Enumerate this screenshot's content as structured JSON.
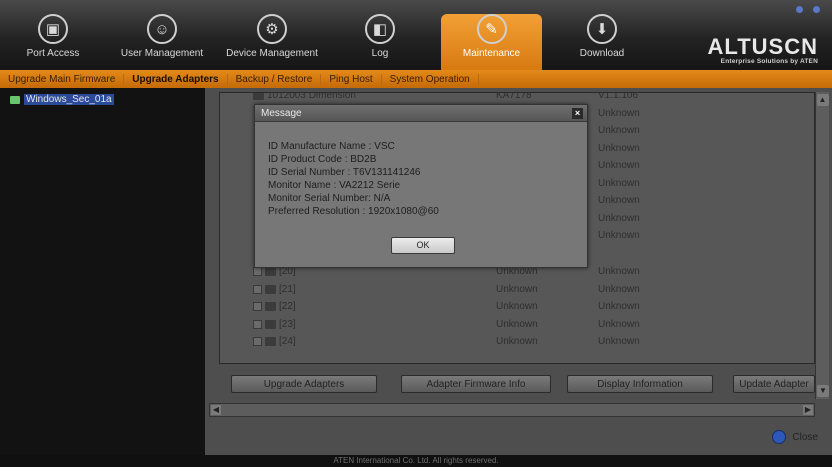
{
  "topbar": {
    "tabs": [
      {
        "label": "Port Access",
        "icon": "monitor-icon"
      },
      {
        "label": "User Management",
        "icon": "users-icon"
      },
      {
        "label": "Device Management",
        "icon": "device-icon"
      },
      {
        "label": "Log",
        "icon": "log-icon"
      },
      {
        "label": "Maintenance",
        "icon": "wrench-icon"
      },
      {
        "label": "Download",
        "icon": "download-icon"
      }
    ],
    "active_tab": "Maintenance",
    "logo": {
      "main": "ALTUSCN",
      "sub": "Enterprise Solutions by ATEN"
    }
  },
  "submenu": {
    "items": [
      "Upgrade Main Firmware",
      "Upgrade Adapters",
      "Backup / Restore",
      "Ping Host",
      "System Operation"
    ],
    "active": "Upgrade Adapters"
  },
  "tree": {
    "item": "Windows_Sec_01a"
  },
  "adapters": {
    "top_row": {
      "name": "1012003  Dimension",
      "model": "KA7178",
      "version": "V1.1.106"
    },
    "rows": [
      {
        "name": "",
        "model": "",
        "version": "Unknown"
      },
      {
        "name": "",
        "model": "",
        "version": "Unknown"
      },
      {
        "name": "",
        "model": "",
        "version": "Unknown"
      },
      {
        "name": "",
        "model": "",
        "version": "Unknown"
      },
      {
        "name": "",
        "model": "",
        "version": "Unknown"
      },
      {
        "name": "",
        "model": "",
        "version": "Unknown"
      },
      {
        "name": "",
        "model": "",
        "version": "Unknown"
      },
      {
        "name": "",
        "model": "",
        "version": "Unknown"
      },
      {
        "name": "[20]",
        "model": "Unknown",
        "version": "Unknown"
      },
      {
        "name": "[21]",
        "model": "Unknown",
        "version": "Unknown"
      },
      {
        "name": "[22]",
        "model": "Unknown",
        "version": "Unknown"
      },
      {
        "name": "[23]",
        "model": "Unknown",
        "version": "Unknown"
      },
      {
        "name": "[24]",
        "model": "Unknown",
        "version": "Unknown"
      }
    ]
  },
  "buttons": {
    "upgrade": "Upgrade Adapters",
    "firmware_info": "Adapter Firmware Info",
    "display_info": "Display Information",
    "update": "Update Adapter"
  },
  "close_label": "Close",
  "footer": "ATEN International Co. Ltd. All rights reserved.",
  "dialog": {
    "title": "Message",
    "close_glyph": "×",
    "lines": [
      "ID Manufacture Name : VSC",
      "ID Product Code : BD2B",
      "ID Serial Number : T6V131141246",
      "Monitor Name : VA2212 Serie",
      "Monitor Serial Number: N/A",
      "Preferred Resolution : 1920x1080@60"
    ],
    "ok_label": "OK"
  },
  "colors": {
    "accent": "#e48a1a",
    "pane": "#4e4e4e"
  }
}
